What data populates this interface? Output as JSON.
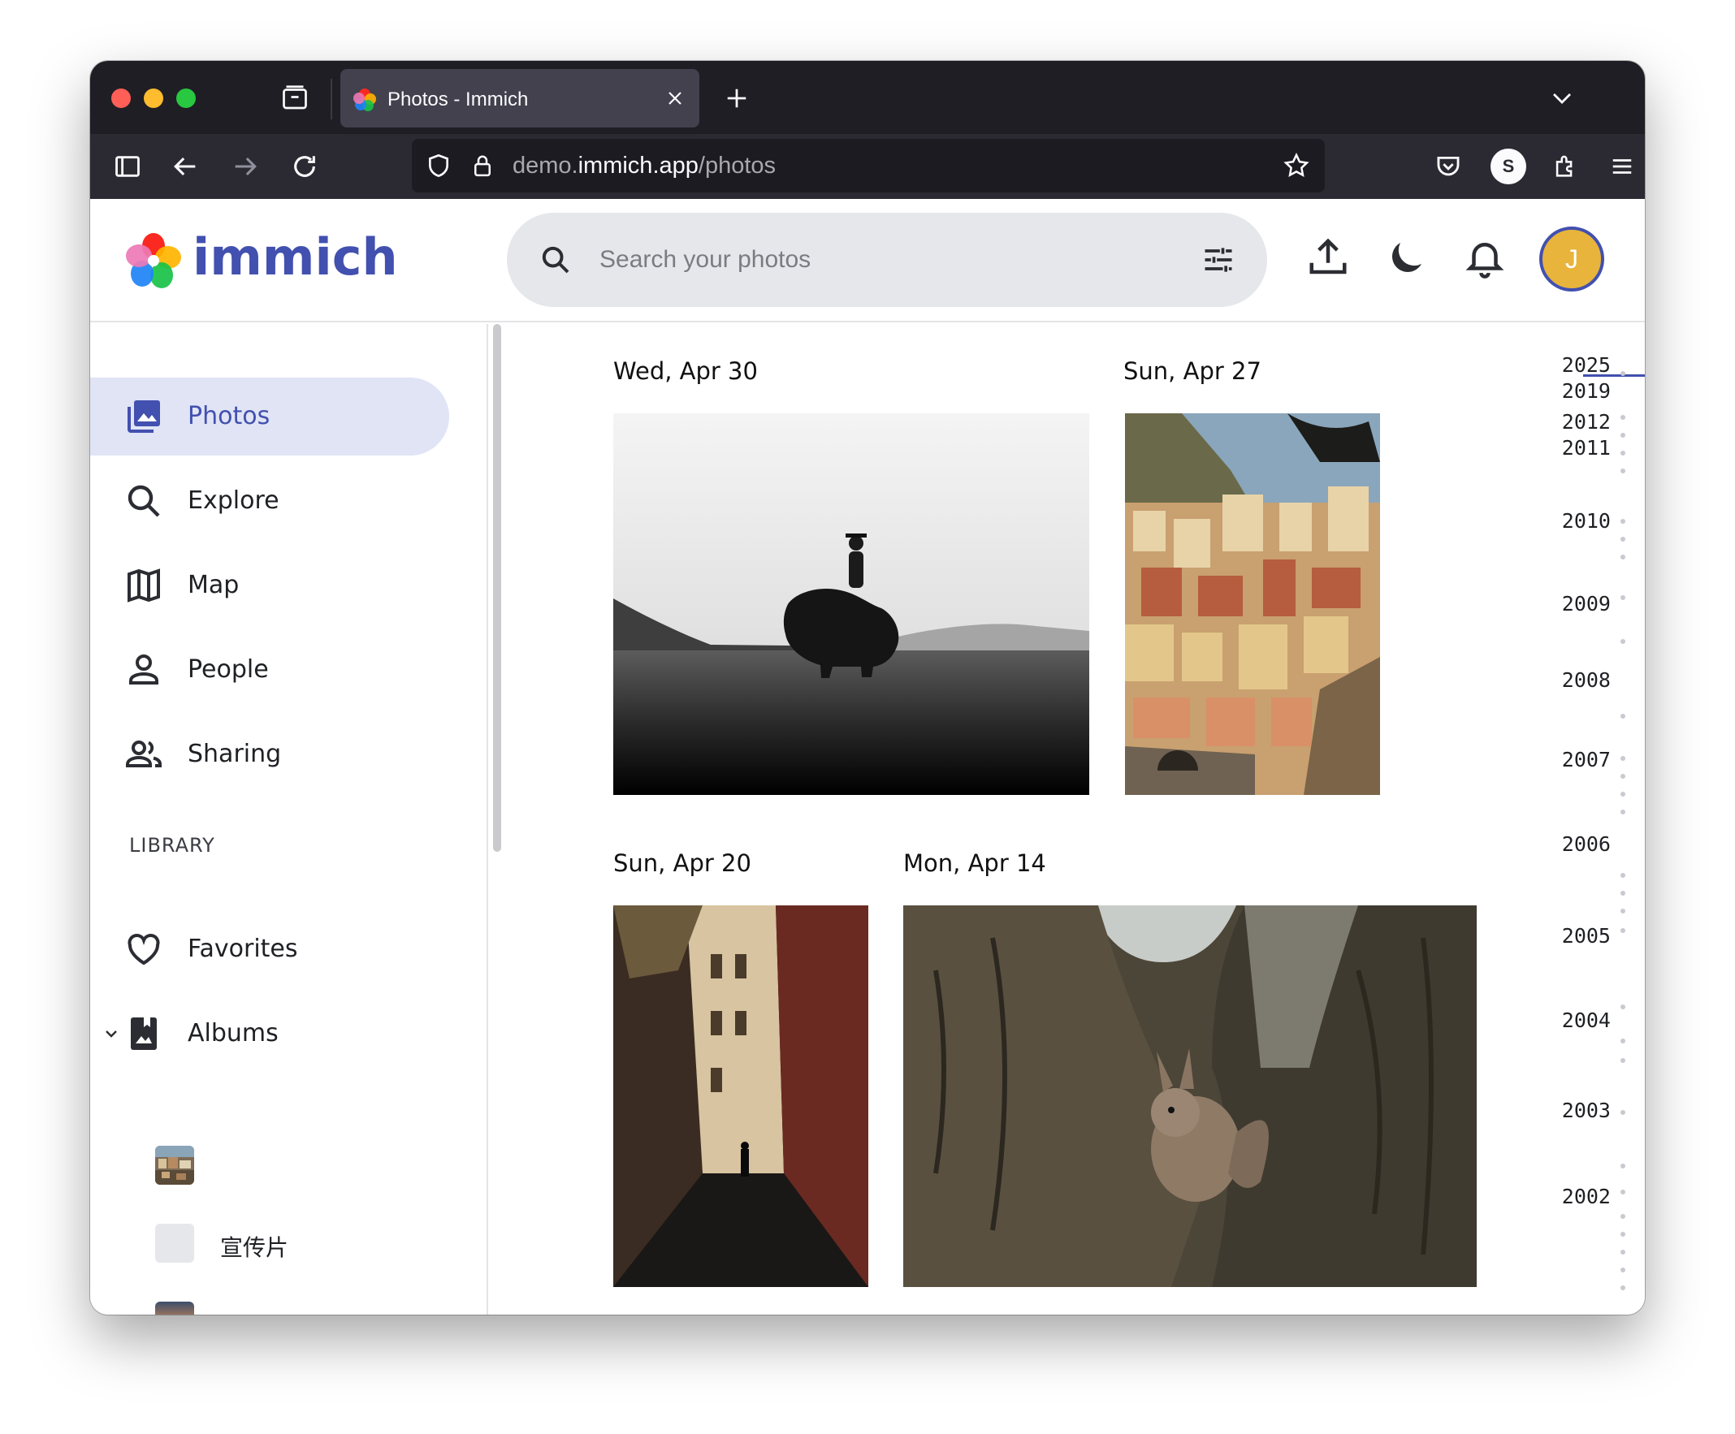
{
  "browser": {
    "tab_title": "Photos - Immich",
    "url_prefix": "demo.",
    "url_host": "immich.app",
    "url_path": "/photos",
    "profile_letter": "S"
  },
  "header": {
    "logo_text": "immich",
    "search_placeholder": "Search your photos",
    "avatar_letter": "J",
    "accent_color": "#4250af",
    "avatar_color": "#e8b43c"
  },
  "sidebar": {
    "items": [
      {
        "label": "Photos",
        "icon": "photos-icon",
        "active": true
      },
      {
        "label": "Explore",
        "icon": "search-icon"
      },
      {
        "label": "Map",
        "icon": "map-icon"
      },
      {
        "label": "People",
        "icon": "person-icon"
      },
      {
        "label": "Sharing",
        "icon": "people-icon"
      }
    ],
    "library_label": "LIBRARY",
    "library_items": [
      {
        "label": "Favorites",
        "icon": "heart-icon"
      },
      {
        "label": "Albums",
        "icon": "album-icon"
      }
    ],
    "albums": [
      {
        "label": "",
        "thumb": "coastal-village"
      },
      {
        "label": "宣传片",
        "thumb": "blank"
      },
      {
        "label": "",
        "thumb": "sunset-boats"
      }
    ]
  },
  "timeline": {
    "groups": [
      {
        "date": "Wed, Apr 30",
        "photos": [
          "bison-rider"
        ]
      },
      {
        "date": "Sun, Apr 27",
        "photos": [
          "cliffside-village"
        ]
      },
      {
        "date": "Sun, Apr 20",
        "photos": [
          "narrow-street"
        ]
      },
      {
        "date": "Mon, Apr 14",
        "photos": [
          "squirrel-tree"
        ]
      }
    ]
  },
  "scrubber": {
    "years": [
      "2025",
      "2019",
      "2012",
      "2011",
      "2010",
      "2009",
      "2008",
      "2007",
      "2006",
      "2005",
      "2004",
      "2003",
      "2002"
    ]
  }
}
